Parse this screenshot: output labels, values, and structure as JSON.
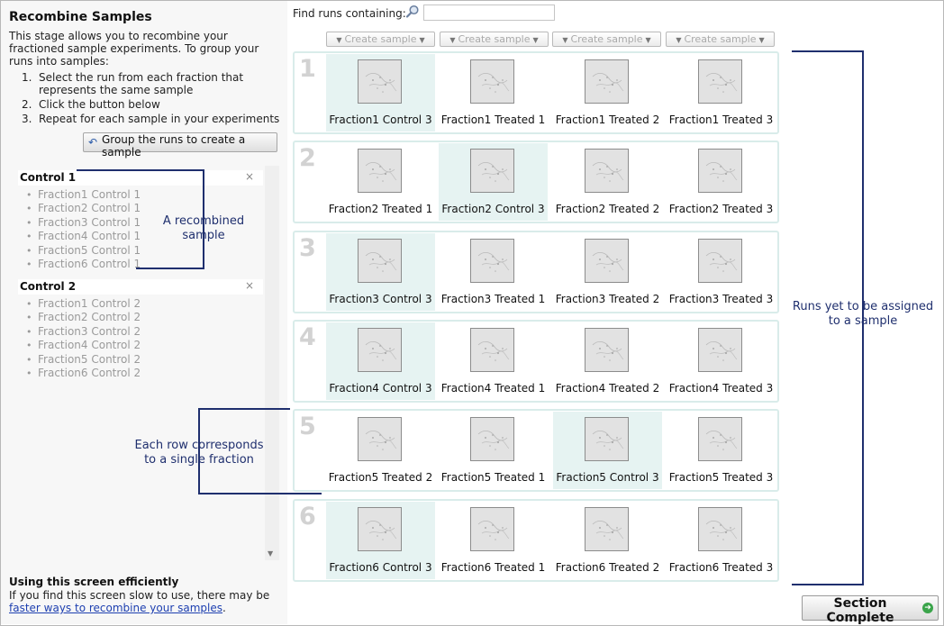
{
  "sidebar": {
    "title": "Recombine Samples",
    "intro": "This stage allows you to recombine your fractioned sample experiments. To group your runs into samples:",
    "steps": [
      {
        "num": "1.",
        "text": "Select the run from each fraction that represents the same sample"
      },
      {
        "num": "2.",
        "text": "Click the button below"
      },
      {
        "num": "3.",
        "text": "Repeat for each sample in your experiments"
      }
    ],
    "group_button": "Group the runs to create a sample",
    "samples": [
      {
        "name": "Control 1",
        "runs": [
          "Fraction1 Control 1",
          "Fraction2 Control 1",
          "Fraction3 Control 1",
          "Fraction4 Control 1",
          "Fraction5 Control 1",
          "Fraction6 Control 1"
        ]
      },
      {
        "name": "Control 2",
        "runs": [
          "Fraction1 Control 2",
          "Fraction2 Control 2",
          "Fraction3 Control 2",
          "Fraction4 Control 2",
          "Fraction5 Control 2",
          "Fraction6 Control 2"
        ]
      }
    ],
    "remove_symbol": "×",
    "efficiency_title": "Using this screen efficiently",
    "efficiency_text": "If you find this screen slow to use, there may be",
    "efficiency_link": "faster ways to recombine your samples",
    "efficiency_end": "."
  },
  "main": {
    "find_label": "Find runs containing:",
    "find_value": "",
    "create_sample_label": "Create sample",
    "rows": [
      {
        "num": "1",
        "cells": [
          {
            "label": "Fraction1 Control 3",
            "highlight": true
          },
          {
            "label": "Fraction1 Treated 1",
            "highlight": false
          },
          {
            "label": "Fraction1 Treated 2",
            "highlight": false
          },
          {
            "label": "Fraction1 Treated 3",
            "highlight": false
          }
        ]
      },
      {
        "num": "2",
        "cells": [
          {
            "label": "Fraction2 Treated 1",
            "highlight": false
          },
          {
            "label": "Fraction2 Control 3",
            "highlight": true
          },
          {
            "label": "Fraction2 Treated 2",
            "highlight": false
          },
          {
            "label": "Fraction2 Treated 3",
            "highlight": false
          }
        ]
      },
      {
        "num": "3",
        "cells": [
          {
            "label": "Fraction3 Control 3",
            "highlight": true
          },
          {
            "label": "Fraction3 Treated 1",
            "highlight": false
          },
          {
            "label": "Fraction3 Treated 2",
            "highlight": false
          },
          {
            "label": "Fraction3 Treated 3",
            "highlight": false
          }
        ]
      },
      {
        "num": "4",
        "cells": [
          {
            "label": "Fraction4 Control 3",
            "highlight": true
          },
          {
            "label": "Fraction4 Treated 1",
            "highlight": false
          },
          {
            "label": "Fraction4 Treated 2",
            "highlight": false
          },
          {
            "label": "Fraction4 Treated 3",
            "highlight": false
          }
        ]
      },
      {
        "num": "5",
        "cells": [
          {
            "label": "Fraction5 Treated 2",
            "highlight": false
          },
          {
            "label": "Fraction5 Treated 1",
            "highlight": false
          },
          {
            "label": "Fraction5 Control 3",
            "highlight": true
          },
          {
            "label": "Fraction5 Treated 3",
            "highlight": false
          }
        ]
      },
      {
        "num": "6",
        "cells": [
          {
            "label": "Fraction6 Control 3",
            "highlight": true
          },
          {
            "label": "Fraction6 Treated 1",
            "highlight": false
          },
          {
            "label": "Fraction6 Treated 2",
            "highlight": false
          },
          {
            "label": "Fraction6 Treated 3",
            "highlight": false
          }
        ]
      }
    ],
    "section_complete": "Section Complete"
  },
  "annotations": {
    "recombined_1": "A recombined",
    "recombined_2": "sample",
    "fraction_1": "Each row corresponds",
    "fraction_2": "to a single fraction",
    "unassigned_1": "Runs yet to be assigned",
    "unassigned_2": "to a sample"
  },
  "icons": {
    "search": "magnifier-icon",
    "dropdown": "triangle-down-icon",
    "remove": "close-icon",
    "thumbnail": "gel-image-icon",
    "complete": "arrow-right-circle-icon"
  },
  "colors": {
    "highlight": "#e6f3f2",
    "row_border": "#d9ecea",
    "annotation": "#1f2f6e",
    "link": "#1d3fb0",
    "go_button": "#3aa44a"
  }
}
